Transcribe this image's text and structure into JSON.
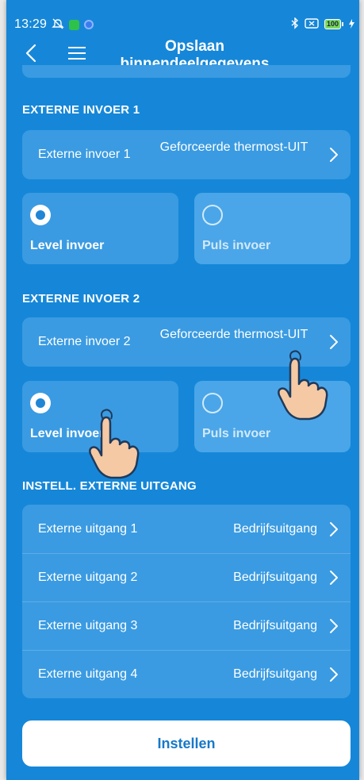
{
  "status_bar": {
    "time": "13:29",
    "battery_level": "100",
    "icons": [
      "mute-icon",
      "app-icon",
      "vpn-icon",
      "bluetooth-icon",
      "no-sim-icon",
      "battery-icon",
      "charging-icon"
    ]
  },
  "header": {
    "title": "Opslaan binnendeelgegevens",
    "back_icon": "chevron-left-icon",
    "menu_icon": "hamburger-menu-icon"
  },
  "external_input_1": {
    "section_title": "EXTERNE INVOER 1",
    "row_label": "Externe invoer 1",
    "row_value": "Geforceerde thermost-UIT",
    "options": [
      {
        "label": "Level invoer",
        "selected": true
      },
      {
        "label": "Puls invoer",
        "selected": false
      }
    ]
  },
  "external_input_2": {
    "section_title": "EXTERNE INVOER 2",
    "row_label": "Externe invoer 2",
    "row_value": "Geforceerde thermost-UIT",
    "options": [
      {
        "label": "Level invoer",
        "selected": true
      },
      {
        "label": "Puls invoer",
        "selected": false
      }
    ]
  },
  "external_output": {
    "section_title": "INSTELL. EXTERNE UITGANG",
    "rows": [
      {
        "label": "Externe uitgang 1",
        "value": "Bedrijfsuitgang"
      },
      {
        "label": "Externe uitgang 2",
        "value": "Bedrijfsuitgang"
      },
      {
        "label": "Externe uitgang 3",
        "value": "Bedrijfsuitgang"
      },
      {
        "label": "Externe uitgang 4",
        "value": "Bedrijfsuitgang"
      }
    ]
  },
  "submit_button": {
    "label": "Instellen"
  },
  "colors": {
    "background": "#1687d8",
    "card": "#3a9be2",
    "button_text": "#1679c9",
    "hand_fill": "#f5c9a4"
  }
}
